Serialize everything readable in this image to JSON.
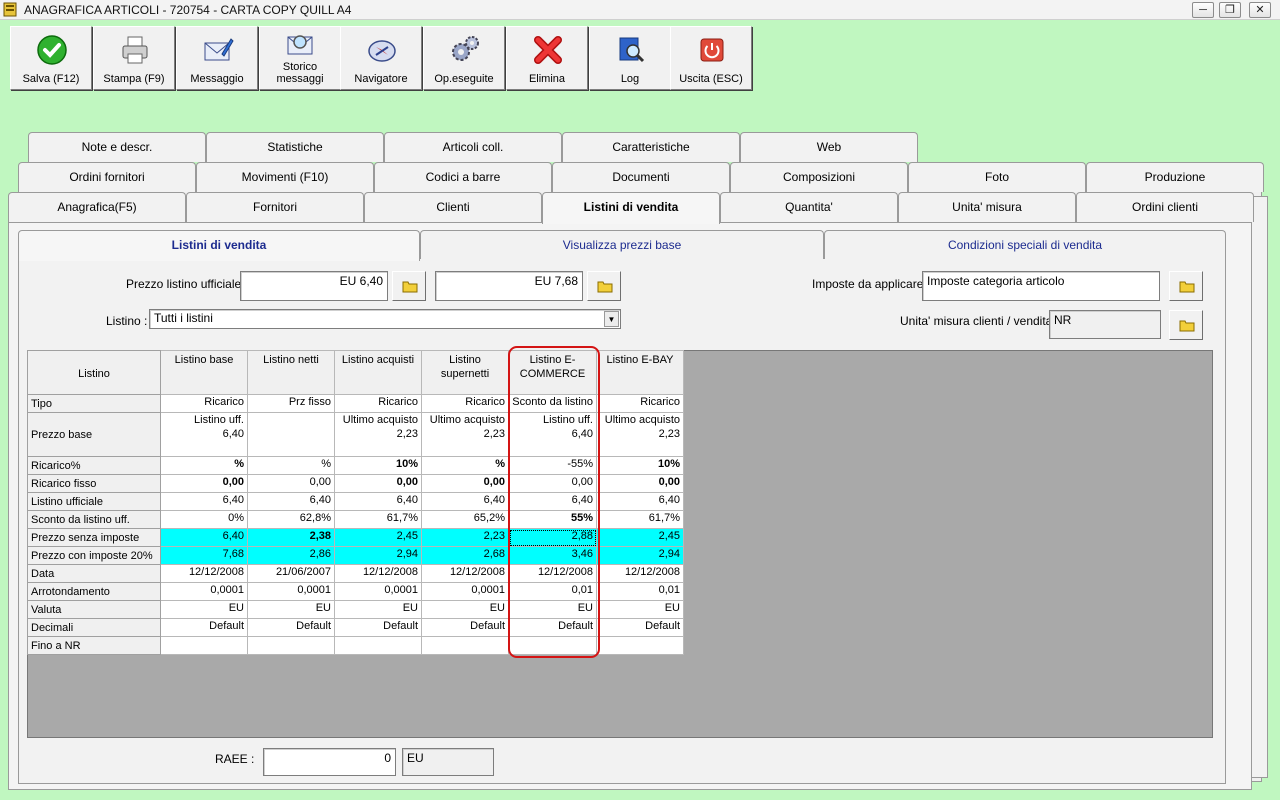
{
  "window": {
    "title": "ANAGRAFICA ARTICOLI - 720754 - CARTA COPY QUILL A4",
    "icon": "app-icon"
  },
  "toolbar": [
    {
      "id": "save",
      "label": "Salva (F12)",
      "icon": "checkmark-icon"
    },
    {
      "id": "print",
      "label": "Stampa (F9)",
      "icon": "printer-icon"
    },
    {
      "id": "message",
      "label": "Messaggio",
      "icon": "envelope-pen-icon"
    },
    {
      "id": "history",
      "label": "Storico messaggi",
      "icon": "envelope-search-icon"
    },
    {
      "id": "navigator",
      "label": "Navigatore",
      "icon": "compass-icon"
    },
    {
      "id": "operations",
      "label": "Op.eseguite",
      "icon": "gears-icon"
    },
    {
      "id": "delete",
      "label": "Elimina",
      "icon": "red-x-icon"
    },
    {
      "id": "log",
      "label": "Log",
      "icon": "book-search-icon"
    },
    {
      "id": "exit",
      "label": "Uscita (ESC)",
      "icon": "power-icon"
    }
  ],
  "tabs": {
    "row1": [
      "Note e descr.",
      "Statistiche",
      "Articoli coll.",
      "Caratteristiche",
      "Web"
    ],
    "row2": [
      "Ordini fornitori",
      "Movimenti (F10)",
      "Codici a barre",
      "Documenti",
      "Composizioni",
      "Foto",
      "Produzione"
    ],
    "row3": [
      "Anagrafica(F5)",
      "Fornitori",
      "Clienti",
      "Listini di vendita",
      "Quantita'",
      "Unita' misura",
      "Ordini clienti"
    ],
    "active": "Listini di vendita"
  },
  "subtabs": {
    "items": [
      "Listini di vendita",
      "Visualizza prezzi base",
      "Condizioni speciali di vendita"
    ],
    "active": "Listini di vendita"
  },
  "form": {
    "prezzo_label": "Prezzo listino ufficiale :",
    "prezzo_value1": "EU 6,40",
    "prezzo_value2": "EU 7,68",
    "listino_label": "Listino :",
    "listino_value": "Tutti i listini",
    "imposte_label": "Imposte da applicare :",
    "imposte_value": "Imposte categoria articolo",
    "unita_label": "Unita' misura clienti / vendita :",
    "unita_value": "NR",
    "raee_label": "RAEE :",
    "raee_value": "0",
    "raee_currency": "EU"
  },
  "grid": {
    "header_label": "Listino",
    "columns": [
      "Listino base",
      "Listino netti",
      "Listino acquisti",
      "Listino supernetti",
      "Listino E-COMMERCE",
      "Listino E-BAY"
    ],
    "rows": [
      {
        "label": "Tipo",
        "values": [
          "Ricarico",
          "Prz fisso",
          "Ricarico",
          "Ricarico",
          "Sconto da listino",
          "Ricarico"
        ]
      },
      {
        "label": "Prezzo base",
        "values": [
          "Listino uff.\n6,40",
          "",
          "Ultimo acquisto\n2,23",
          "Ultimo acquisto\n2,23",
          "Listino uff.\n6,40",
          "Ultimo acquisto\n2,23"
        ]
      },
      {
        "label": "Ricarico%",
        "values": [
          "%",
          "%",
          "10%",
          "%",
          "-55%",
          "10%"
        ]
      },
      {
        "label": "Ricarico fisso",
        "values": [
          "0,00",
          "0,00",
          "0,00",
          "0,00",
          "0,00",
          "0,00"
        ]
      },
      {
        "label": "Listino ufficiale",
        "values": [
          "6,40",
          "6,40",
          "6,40",
          "6,40",
          "6,40",
          "6,40"
        ]
      },
      {
        "label": "Sconto da listino uff.",
        "values": [
          "0%",
          "62,8%",
          "61,7%",
          "65,2%",
          "55%",
          "61,7%"
        ]
      },
      {
        "label": "Prezzo senza imposte",
        "values": [
          "6,40",
          "2,38",
          "2,45",
          "2,23",
          "2,88",
          "2,45"
        ]
      },
      {
        "label": "Prezzo con imposte 20%",
        "values": [
          "7,68",
          "2,86",
          "2,94",
          "2,68",
          "3,46",
          "2,94"
        ]
      },
      {
        "label": "Data",
        "values": [
          "12/12/2008",
          "21/06/2007",
          "12/12/2008",
          "12/12/2008",
          "12/12/2008",
          "12/12/2008"
        ]
      },
      {
        "label": "Arrotondamento",
        "values": [
          "0,0001",
          "0,0001",
          "0,0001",
          "0,0001",
          "0,01",
          "0,01"
        ]
      },
      {
        "label": "Valuta",
        "values": [
          "EU",
          "EU",
          "EU",
          "EU",
          "EU",
          "EU"
        ]
      },
      {
        "label": "Decimali",
        "values": [
          "Default",
          "Default",
          "Default",
          "Default",
          "Default",
          "Default"
        ]
      },
      {
        "label": "Fino a NR",
        "values": [
          "",
          "",
          "",
          "",
          "",
          ""
        ]
      }
    ],
    "highlight_color": "#00ffff",
    "outline_color": "#d41414"
  }
}
